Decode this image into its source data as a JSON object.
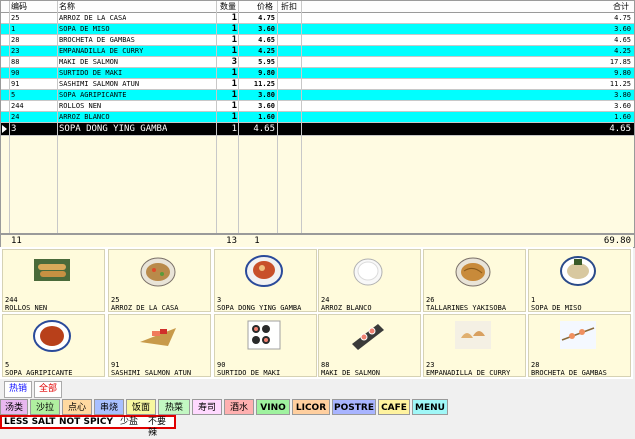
{
  "order": {
    "headers": {
      "code": "编码",
      "name": "名称",
      "qty": "数量",
      "price": "价格",
      "discount": "折扣",
      "total": "合计"
    },
    "rows": [
      {
        "code": "25",
        "name": "ARROZ DE LA CASA",
        "qty": "1",
        "price": "4.75",
        "total": "4.75"
      },
      {
        "code": "1",
        "name": "SOPA DE MISO",
        "qty": "1",
        "price": "3.60",
        "total": "3.60"
      },
      {
        "code": "28",
        "name": "BROCHETA DE GAMBAS",
        "qty": "1",
        "price": "4.65",
        "total": "4.65"
      },
      {
        "code": "23",
        "name": "EMPANADILLA DE CURRY",
        "qty": "1",
        "price": "4.25",
        "total": "4.25"
      },
      {
        "code": "88",
        "name": "MAKI DE SALMON",
        "qty": "3",
        "price": "5.95",
        "total": "17.85"
      },
      {
        "code": "90",
        "name": "SURTIDO DE MAKI",
        "qty": "1",
        "price": "9.80",
        "total": "9.80"
      },
      {
        "code": "91",
        "name": "SASHIMI SALMON ATUN",
        "qty": "1",
        "price": "11.25",
        "total": "11.25"
      },
      {
        "code": "5",
        "name": "SOPA AGRIPICANTE",
        "qty": "1",
        "price": "3.80",
        "total": "3.80"
      },
      {
        "code": "244",
        "name": "ROLLOS NEN",
        "qty": "1",
        "price": "3.60",
        "total": "3.60"
      },
      {
        "code": "24",
        "name": "ARROZ BLANCO",
        "qty": "1",
        "price": "1.60",
        "total": "1.60"
      },
      {
        "code": "3",
        "name": "SOPA DONG YING GAMBA",
        "qty": "1",
        "price": "4.65",
        "total": "4.65"
      }
    ],
    "footer": {
      "count": "11",
      "qty": "13",
      "price": "1",
      "total": "69.80"
    }
  },
  "menu_items": [
    {
      "qty": "244",
      "name": "ROLLOS NEN",
      "icon": "spring-rolls-icon"
    },
    {
      "qty": "25",
      "name": "ARROZ DE LA CASA",
      "icon": "fried-rice-icon"
    },
    {
      "qty": "3",
      "name": "SOPA DONG YING GAMBA",
      "icon": "soup-bowl-icon"
    },
    {
      "qty": "24",
      "name": "ARROZ BLANCO",
      "icon": "white-rice-icon"
    },
    {
      "qty": "26",
      "name": "TALLARINES YAKISOBA",
      "icon": "noodles-icon"
    },
    {
      "qty": "1",
      "name": "SOPA DE MISO",
      "icon": "miso-soup-icon"
    },
    {
      "qty": "5",
      "name": "SOPA AGRIPICANTE",
      "icon": "spicy-soup-icon"
    },
    {
      "qty": "91",
      "name": "SASHIMI SALMON ATUN",
      "icon": "sashimi-boat-icon"
    },
    {
      "qty": "90",
      "name": "SURTIDO DE MAKI",
      "icon": "maki-plate-icon"
    },
    {
      "qty": "88",
      "name": "MAKI DE SALMON",
      "icon": "salmon-maki-icon"
    },
    {
      "qty": "23",
      "name": "EMPANADILLA DE CURRY",
      "icon": "dumplings-icon"
    },
    {
      "qty": "28",
      "name": "BROCHETA DE GAMBAS",
      "icon": "skewers-icon"
    }
  ],
  "tabs": {
    "hot": "热销",
    "all": "全部"
  },
  "categories": [
    {
      "label": "汤类",
      "color": "#e8b7ef"
    },
    {
      "label": "沙拉",
      "color": "#b0f0a0"
    },
    {
      "label": "点心",
      "color": "#ffd9a0"
    },
    {
      "label": "串烧",
      "color": "#a8c0ff"
    },
    {
      "label": "饭面",
      "color": "#f7f7a0"
    },
    {
      "label": "热菜",
      "color": "#c2f7c2"
    },
    {
      "label": "寿司",
      "color": "#ffd9ff"
    },
    {
      "label": "酒水",
      "color": "#ffb0b0"
    },
    {
      "label": "VINO",
      "color": "#9ff29f"
    },
    {
      "label": "LICOR",
      "color": "#ffcf9f"
    },
    {
      "label": "POSTRE",
      "color": "#a8b4ff"
    },
    {
      "label": "CAFE",
      "color": "#fff39f"
    },
    {
      "label": "MENU",
      "color": "#a0f7f7"
    }
  ],
  "notes": [
    "LESS SALT",
    "NOT SPICY",
    "少盐",
    "不要辣"
  ]
}
